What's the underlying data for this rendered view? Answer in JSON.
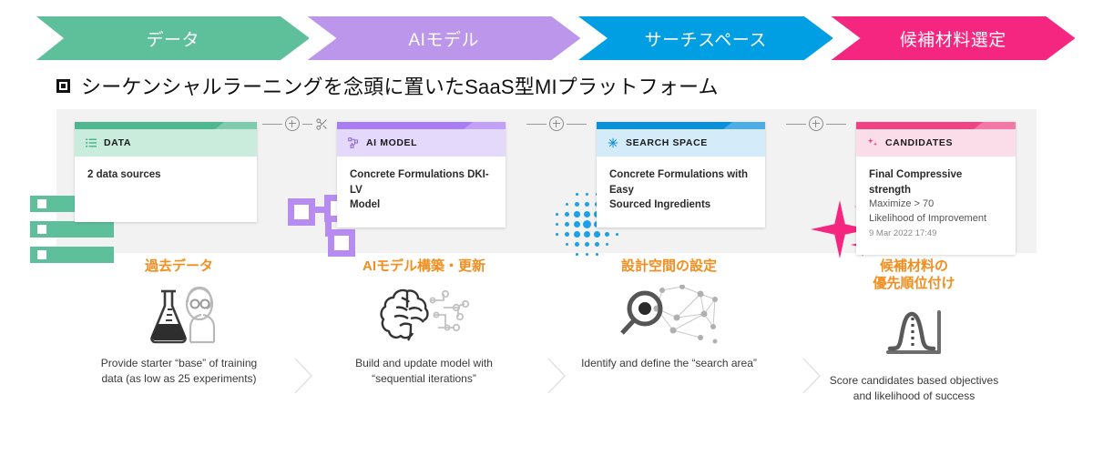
{
  "banner": {
    "steps": [
      {
        "label": "データ",
        "color": "#5ec09b"
      },
      {
        "label": "AIモデル",
        "color": "#bb96ea"
      },
      {
        "label": "サーチスペース",
        "color": "#009fe3"
      },
      {
        "label": "候補材料選定",
        "color": "#f5267f"
      }
    ]
  },
  "title": {
    "bullet": "square-bullet-icon",
    "text": "シーケンシャルラーニングを念頭に置いたSaaS型MIプラットフォーム"
  },
  "cards": [
    {
      "id": "data",
      "icon": "list-icon",
      "header": "DATA",
      "bar_color": "#4fb690",
      "head_bg": "#c9ecdd",
      "lines": [
        "2 data sources"
      ]
    },
    {
      "id": "model",
      "icon": "model-graph-icon",
      "header": "AI MODEL",
      "bar_color": "#a87df0",
      "head_bg": "#e5d9fb",
      "lines": [
        "Concrete Formulations DKI-LV",
        "Model"
      ]
    },
    {
      "id": "search",
      "icon": "grid-sparkle-icon",
      "header": "SEARCH SPACE",
      "bar_color": "#0a8fd8",
      "head_bg": "#d4ecfa",
      "lines": [
        "Concrete Formulations with Easy",
        "Sourced Ingredients"
      ]
    },
    {
      "id": "candidates",
      "icon": "sparkles-icon",
      "header": "CANDIDATES",
      "bar_color": "#ef4484",
      "head_bg": "#fbdde9",
      "title_line": "Final Compressive strength",
      "sub_lines": [
        "Maximize > 70",
        "Likelihood of Improvement"
      ],
      "meta": "9 Mar 2022 17:49"
    }
  ],
  "connectors": [
    {
      "id": "data-to-model",
      "icons": [
        "line",
        "plus-circle-icon",
        "scissors-icon"
      ]
    },
    {
      "id": "model-to-search",
      "icons": [
        "line",
        "plus-circle-icon",
        "line"
      ]
    },
    {
      "id": "search-to-candidates",
      "icons": [
        "line",
        "plus-circle-icon",
        "line"
      ]
    }
  ],
  "decorations": [
    {
      "id": "green-list-bars",
      "name": "list-bars-decoration",
      "color": "#5ec09b"
    },
    {
      "id": "purple-nodes",
      "name": "node-graph-decoration",
      "color": "#b78cf0"
    },
    {
      "id": "blue-dots",
      "name": "dot-matrix-decoration",
      "color": "#1ca0e8"
    },
    {
      "id": "pink-stars",
      "name": "sparkle-decoration",
      "color": "#f5267f"
    }
  ],
  "steps": [
    {
      "label": "過去データ",
      "icon": "scientist-flask-icon",
      "caption": "Provide starter “base” of training data (as low as 25 experiments)"
    },
    {
      "label": "AIモデル構築・更新",
      "icon": "brain-circuit-icon",
      "caption": "Build and update model with “sequential iterations”"
    },
    {
      "label": "設計空間の設定",
      "icon": "magnifier-network-icon",
      "caption": "Identify and define the “search area”"
    },
    {
      "label": "候補材料の\n優先順位付け",
      "icon": "bell-curve-icon",
      "caption": "Score candidates based objectives and likelihood of success"
    }
  ],
  "colors": {
    "green": "#5ec09b",
    "purple": "#bb96ea",
    "blue": "#009fe3",
    "pink": "#f5267f",
    "orange": "#f28e1e",
    "stage_bg": "#f2f2f2"
  }
}
